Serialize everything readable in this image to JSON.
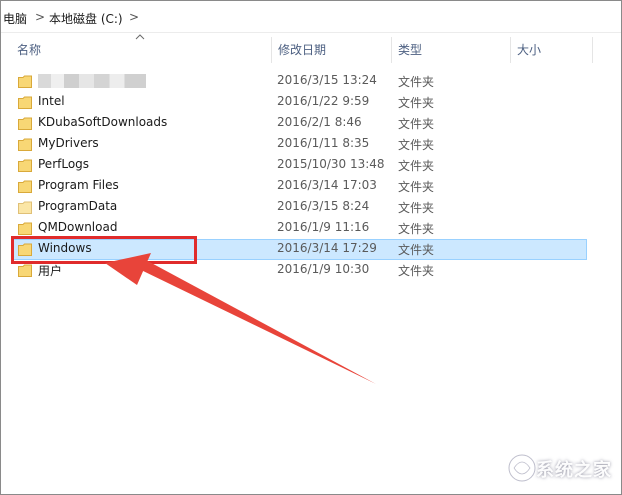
{
  "breadcrumb": {
    "items": [
      "电脑",
      "本地磁盘 (C:)"
    ],
    "separator": ">"
  },
  "columns": {
    "name": "名称",
    "date": "修改日期",
    "type": "类型",
    "size": "大小"
  },
  "rows": [
    {
      "name": "",
      "date": "2016/3/15 13:24",
      "type": "文件夹",
      "blurred": true
    },
    {
      "name": "Intel",
      "date": "2016/1/22 9:59",
      "type": "文件夹"
    },
    {
      "name": "KDubaSoftDownloads",
      "date": "2016/2/1 8:46",
      "type": "文件夹"
    },
    {
      "name": "MyDrivers",
      "date": "2016/1/11 8:35",
      "type": "文件夹"
    },
    {
      "name": "PerfLogs",
      "date": "2015/10/30 13:48",
      "type": "文件夹"
    },
    {
      "name": "Program Files",
      "date": "2016/3/14 17:03",
      "type": "文件夹"
    },
    {
      "name": "ProgramData",
      "date": "2016/3/15 8:24",
      "type": "文件夹"
    },
    {
      "name": "QMDownload",
      "date": "2016/1/9 11:16",
      "type": "文件夹"
    },
    {
      "name": "Windows",
      "date": "2016/3/14 17:29",
      "type": "文件夹",
      "selected": true
    },
    {
      "name": "用户",
      "date": "2016/1/9 10:30",
      "type": "文件夹"
    }
  ],
  "colors": {
    "selection_bg": "#cce8ff",
    "selection_border": "#99d1ff",
    "annotation_red": "#e02b2b",
    "folder_yellow": "#f8d775"
  },
  "icons": {
    "folder": "folder-icon",
    "sort": "sort-ascending-icon",
    "breadcrumb_sep": "chevron-right-icon"
  },
  "watermark": {
    "text": "系统之家"
  }
}
